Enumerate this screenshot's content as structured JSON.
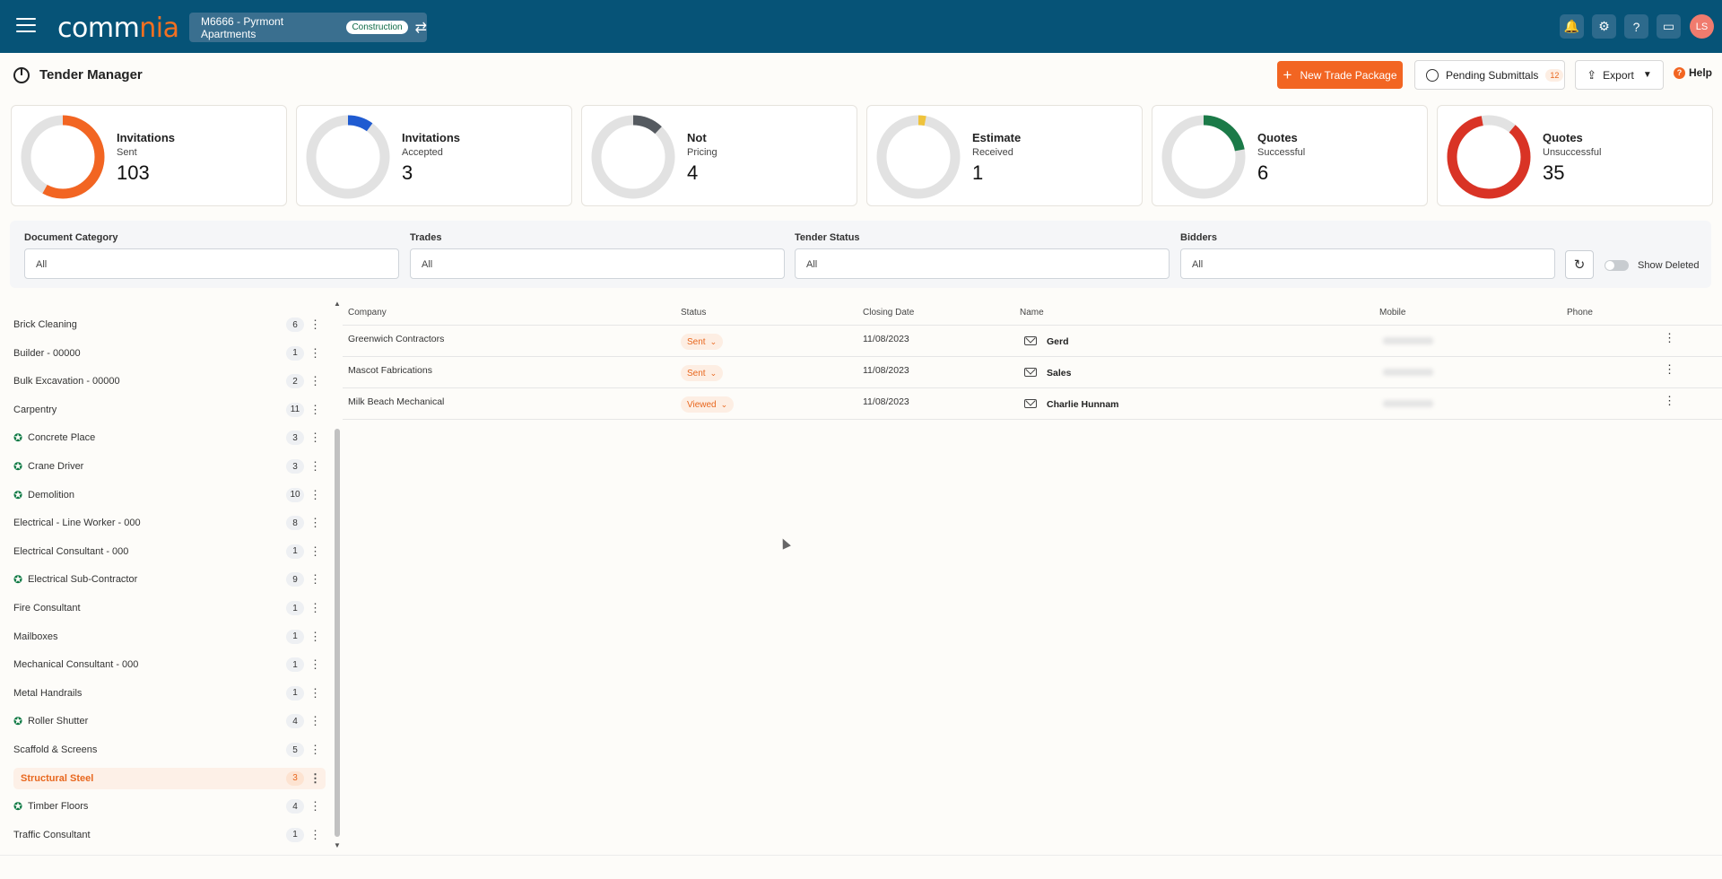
{
  "header": {
    "logo_text_a": "comm",
    "logo_text_b": "nia",
    "project_name": "M6666 - Pyrmont Apartments",
    "project_badge": "Construction",
    "avatar_initials": "LS"
  },
  "toolbar": {
    "title": "Tender Manager",
    "new_button": "New Trade Package",
    "pending_label": "Pending Submittals",
    "pending_count": "12",
    "export_label": "Export",
    "help_label": "Help"
  },
  "stats": [
    {
      "title": "Invitations",
      "subtitle": "Sent",
      "value": "103",
      "fraction": 0.58,
      "start": 0.0,
      "color": "#f26522"
    },
    {
      "title": "Invitations",
      "subtitle": "Accepted",
      "value": "3",
      "fraction": 0.1,
      "start": 0.0,
      "color": "#1f5bd1"
    },
    {
      "title": "Not",
      "subtitle": "Pricing",
      "value": "4",
      "fraction": 0.12,
      "start": 0.0,
      "color": "#555a60"
    },
    {
      "title": "Estimate",
      "subtitle": "Received",
      "value": "1",
      "fraction": 0.03,
      "start": 0.0,
      "color": "#efc33c"
    },
    {
      "title": "Quotes",
      "subtitle": "Successful",
      "value": "6",
      "fraction": 0.22,
      "start": 0.0,
      "color": "#1b7a48"
    },
    {
      "title": "Quotes",
      "subtitle": "Unsuccessful",
      "value": "35",
      "fraction": 0.86,
      "start": 0.11,
      "color": "#d93325"
    }
  ],
  "filters": {
    "doc_category_label": "Document Category",
    "doc_category_value": "All",
    "trades_label": "Trades",
    "trades_value": "All",
    "tender_status_label": "Tender Status",
    "tender_status_value": "All",
    "bidders_label": "Bidders",
    "bidders_value": "All",
    "show_deleted_label": "Show Deleted",
    "show_deleted": false
  },
  "sidebar": {
    "items": [
      {
        "label": "Brick Cleaning",
        "count": "6",
        "ribbon": false
      },
      {
        "label": "Builder - 00000",
        "count": "1",
        "ribbon": false
      },
      {
        "label": "Bulk Excavation - 00000",
        "count": "2",
        "ribbon": false
      },
      {
        "label": "Carpentry",
        "count": "11",
        "ribbon": false
      },
      {
        "label": "Concrete Place",
        "count": "3",
        "ribbon": true
      },
      {
        "label": "Crane Driver",
        "count": "3",
        "ribbon": true
      },
      {
        "label": "Demolition",
        "count": "10",
        "ribbon": true
      },
      {
        "label": "Electrical - Line Worker - 000",
        "count": "8",
        "ribbon": false
      },
      {
        "label": "Electrical Consultant - 000",
        "count": "1",
        "ribbon": false
      },
      {
        "label": "Electrical Sub-Contractor",
        "count": "9",
        "ribbon": true
      },
      {
        "label": "Fire Consultant",
        "count": "1",
        "ribbon": false
      },
      {
        "label": "Mailboxes",
        "count": "1",
        "ribbon": false
      },
      {
        "label": "Mechanical Consultant - 000",
        "count": "1",
        "ribbon": false
      },
      {
        "label": "Metal Handrails",
        "count": "1",
        "ribbon": false
      },
      {
        "label": "Roller Shutter",
        "count": "4",
        "ribbon": true
      },
      {
        "label": "Scaffold & Screens",
        "count": "5",
        "ribbon": false
      },
      {
        "label": "Structural Steel",
        "count": "3",
        "ribbon": false,
        "active": true
      },
      {
        "label": "Timber Floors",
        "count": "4",
        "ribbon": true
      },
      {
        "label": "Traffic Consultant",
        "count": "1",
        "ribbon": false
      }
    ]
  },
  "table": {
    "columns": [
      "Company",
      "Status",
      "Closing Date",
      "Name",
      "Mobile",
      "Phone"
    ],
    "rows": [
      {
        "company": "Greenwich Contractors",
        "status": "Sent",
        "closing": "11/08/2023",
        "name": "Gerd"
      },
      {
        "company": "Mascot Fabrications",
        "status": "Sent",
        "closing": "11/08/2023",
        "name": "Sales"
      },
      {
        "company": "Milk Beach Mechanical",
        "status": "Viewed",
        "closing": "11/08/2023",
        "name": "Charlie Hunnam"
      }
    ]
  }
}
